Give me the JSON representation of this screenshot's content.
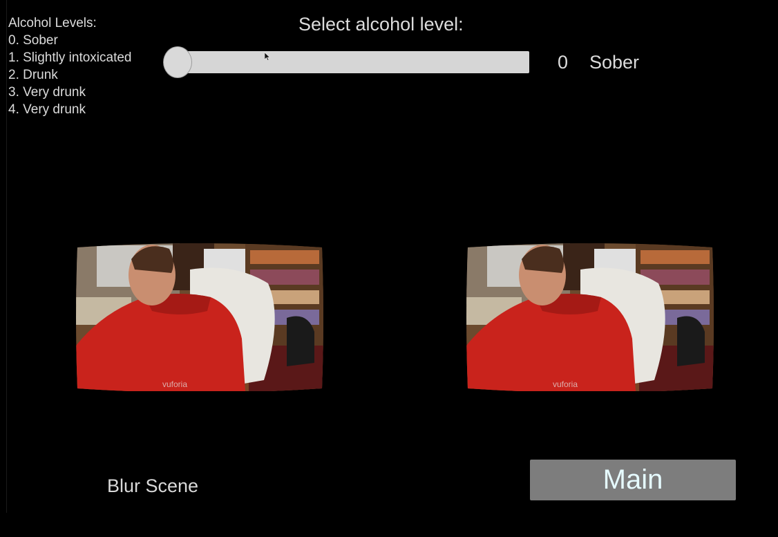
{
  "levels_panel": {
    "title": "Alcohol Levels:",
    "items": [
      "0. Sober",
      "1. Slightly intoxicated",
      "2. Drunk",
      "3. Very drunk",
      "4. Very drunk"
    ]
  },
  "slider": {
    "title": "Select alcohol level:",
    "value_text": "0",
    "level_name": "Sober",
    "fill_fraction": 0
  },
  "viewer": {
    "watermark": "vuforia"
  },
  "footer": {
    "blur_label": "Blur Scene",
    "main_button_label": "Main"
  },
  "colors": {
    "background": "#000000",
    "text": "#dcdcdc",
    "slider_track": "#d6d6d6",
    "button_bg": "#7d7d7d",
    "button_text": "#e6fbff"
  },
  "icons": {
    "cursor": "mouse-pointer-icon"
  }
}
